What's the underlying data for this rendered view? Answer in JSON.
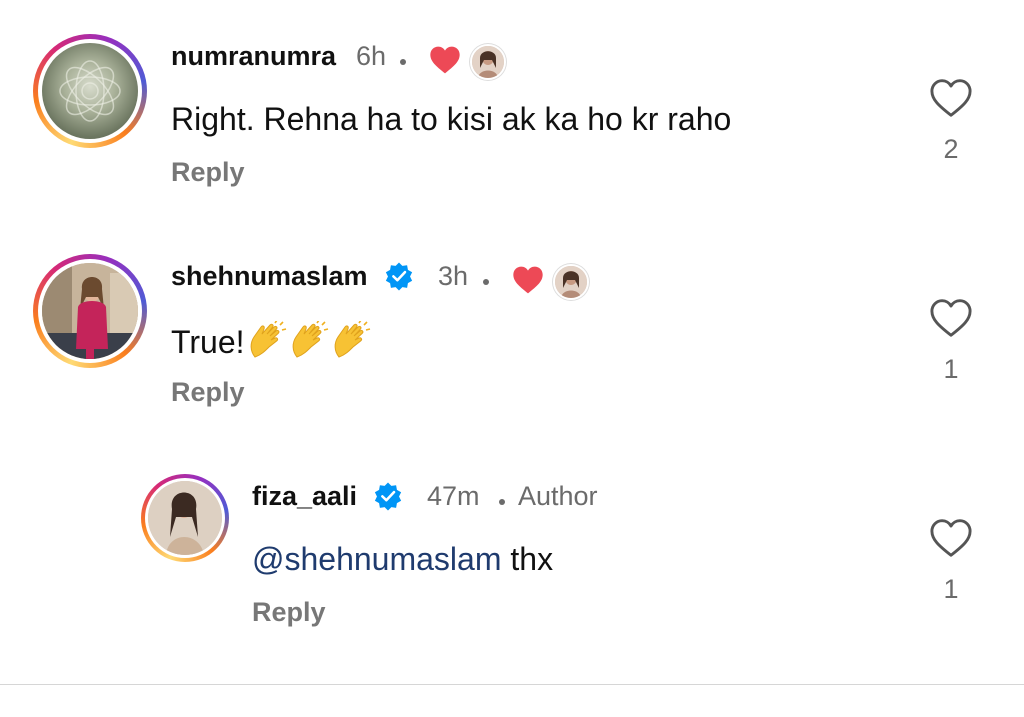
{
  "comments": [
    {
      "username": "numranumra",
      "verified": false,
      "time": "6h",
      "author_tag": "",
      "text": "Right. Rehna ha to kisi ak ka ho kr raho",
      "reply_label": "Reply",
      "like_count": "2",
      "liked_by_author": true
    },
    {
      "username": "shehnumaslam",
      "verified": true,
      "time": "3h",
      "author_tag": "",
      "text": "True!",
      "emoji": [
        "clapping-hands",
        "clapping-hands",
        "clapping-hands"
      ],
      "reply_label": "Reply",
      "like_count": "1",
      "liked_by_author": true
    },
    {
      "username": "fiza_aali",
      "verified": true,
      "time": "47m",
      "author_tag": "Author",
      "mention": "@shehnumaslam",
      "text": " thx",
      "reply_label": "Reply",
      "like_count": "1",
      "liked_by_author": false
    }
  ],
  "colors": {
    "like_heart": "#ed4956",
    "verified_badge": "#0095f6",
    "mention": "#1f3b6e",
    "meta_text": "#6b6b6b"
  },
  "icons": {
    "like": "heart-outline-icon",
    "liked_by_author": "heart-filled-icon",
    "verified": "verified-badge-icon"
  }
}
